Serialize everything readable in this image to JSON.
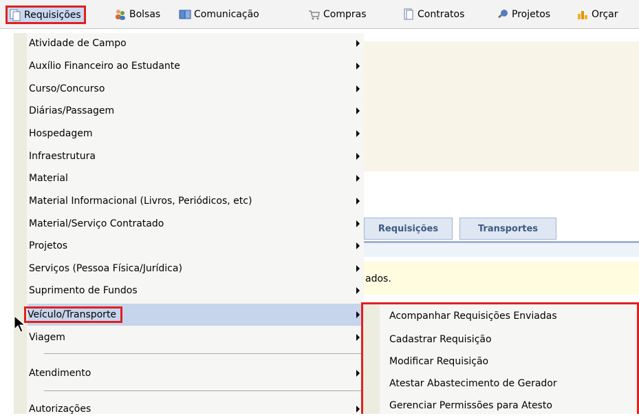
{
  "menubar": {
    "items": [
      {
        "label": "Requisições",
        "icon": "documents-icon"
      },
      {
        "label": "Bolsas",
        "icon": "people-icon"
      },
      {
        "label": "Comunicação",
        "icon": "book-icon"
      },
      {
        "label": "Compras",
        "icon": "cart-icon"
      },
      {
        "label": "Contratos",
        "icon": "document-icon"
      },
      {
        "label": "Projetos",
        "icon": "wrench-icon"
      },
      {
        "label": "Orçar",
        "icon": "bars-icon"
      }
    ]
  },
  "background": {
    "tabs": [
      "Requisições",
      "Transportes"
    ],
    "text": "ados."
  },
  "dropdown": {
    "items": [
      "Atividade de Campo",
      "Auxílio Financeiro ao Estudante",
      "Curso/Concurso",
      "Diárias/Passagem",
      "Hospedagem",
      "Infraestrutura",
      "Material",
      "Material Informacional (Livros, Periódicos, etc)",
      "Material/Serviço Contratado",
      "Projetos",
      "Serviços (Pessoa Física/Jurídica)",
      "Suprimento de Fundos",
      "Veículo/Transporte",
      "Viagem",
      "Atendimento",
      "Autorizações"
    ]
  },
  "submenu": {
    "items": [
      "Acompanhar Requisições Enviadas",
      "Cadastrar Requisição",
      "Modificar Requisição",
      "Atestar Abastecimento de Gerador",
      "Gerenciar Permissões para Atesto"
    ]
  },
  "colors": {
    "highlight": "#e02020",
    "selection": "#c6d4ec"
  }
}
